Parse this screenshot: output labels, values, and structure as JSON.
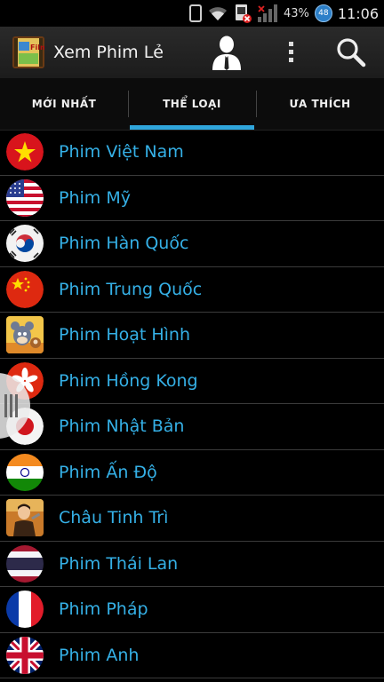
{
  "status_bar": {
    "battery": "43%",
    "badge": "48",
    "time": "11:06",
    "icons": [
      "vibrate-icon",
      "wifi-icon",
      "sim-blocked-icon",
      "signal-icon",
      "battery-icon"
    ]
  },
  "app": {
    "title": "Xem Phim Lẻ",
    "icons": [
      "app-logo",
      "user-icon",
      "overflow-menu-icon",
      "search-icon"
    ]
  },
  "tabs": [
    {
      "label": "MỚI NHẤT",
      "active": false
    },
    {
      "label": "THỂ LOẠI",
      "active": true
    },
    {
      "label": "ƯA THÍCH",
      "active": false
    }
  ],
  "categories": [
    {
      "label": "Phim Việt Nam",
      "icon": "vietnam-flag-icon"
    },
    {
      "label": "Phim Mỹ",
      "icon": "usa-flag-icon"
    },
    {
      "label": "Phim Hàn Quốc",
      "icon": "korea-flag-icon"
    },
    {
      "label": "Phim Trung Quốc",
      "icon": "china-flag-icon"
    },
    {
      "label": "Phim Hoạt Hình",
      "icon": "cartoon-icon"
    },
    {
      "label": "Phim Hồng Kong",
      "icon": "hongkong-flag-icon"
    },
    {
      "label": "Phim Nhật Bản",
      "icon": "japan-flag-icon"
    },
    {
      "label": "Phim Ấn Độ",
      "icon": "india-flag-icon"
    },
    {
      "label": "Châu Tinh Trì",
      "icon": "actor-photo-icon"
    },
    {
      "label": "Phim Thái Lan",
      "icon": "thailand-flag-icon"
    },
    {
      "label": "Phim Pháp",
      "icon": "france-flag-icon"
    },
    {
      "label": "Phim Anh",
      "icon": "uk-flag-icon"
    }
  ],
  "colors": {
    "accent": "#2fa6dc",
    "label": "#35b0e6",
    "background": "#000000"
  }
}
